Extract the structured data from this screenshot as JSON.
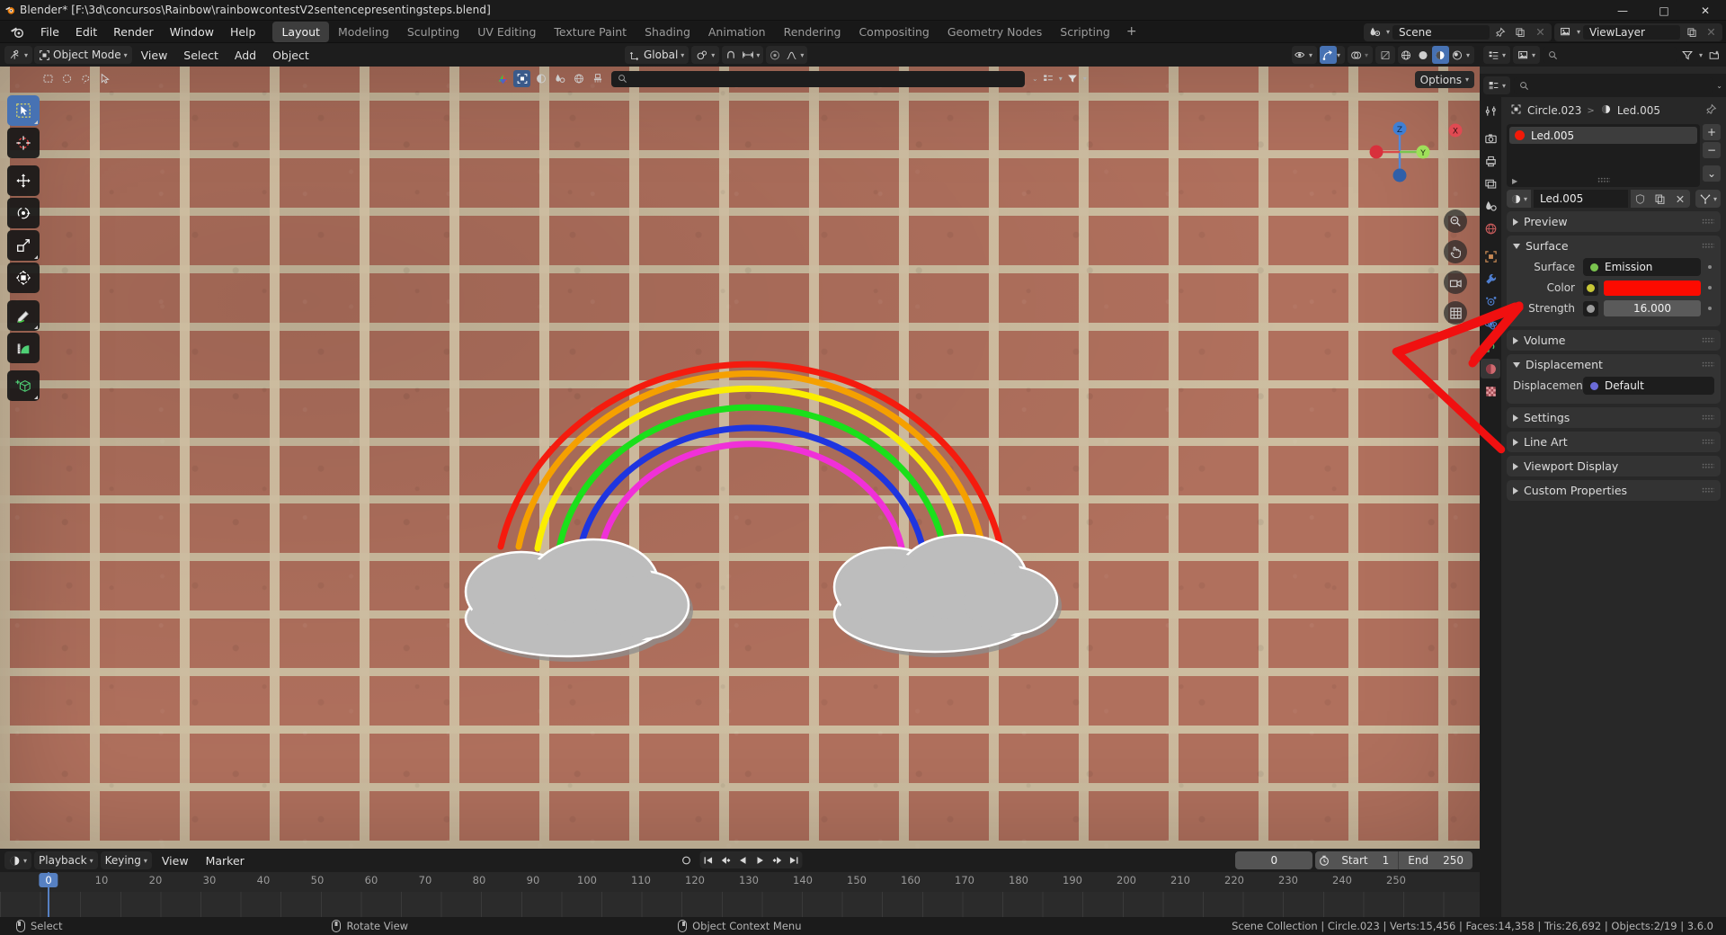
{
  "window": {
    "title": "Blender* [F:\\3d\\concursos\\Rainbow\\rainbowcontestV2sentencepresentingsteps.blend]",
    "minimize": "—",
    "maximize": "□",
    "close": "✕"
  },
  "topbar": {
    "menus": [
      "File",
      "Edit",
      "Render",
      "Window",
      "Help"
    ],
    "workspaces": [
      {
        "label": "Layout",
        "active": true
      },
      {
        "label": "Modeling",
        "active": false
      },
      {
        "label": "Sculpting",
        "active": false
      },
      {
        "label": "UV Editing",
        "active": false
      },
      {
        "label": "Texture Paint",
        "active": false
      },
      {
        "label": "Shading",
        "active": false
      },
      {
        "label": "Animation",
        "active": false
      },
      {
        "label": "Rendering",
        "active": false
      },
      {
        "label": "Compositing",
        "active": false
      },
      {
        "label": "Geometry Nodes",
        "active": false
      },
      {
        "label": "Scripting",
        "active": false
      }
    ],
    "add_workspace": "+",
    "scene_name": "Scene",
    "view_layer_name": "ViewLayer"
  },
  "viewport": {
    "mode": "Object Mode",
    "menus": [
      "View",
      "Select",
      "Add",
      "Object"
    ],
    "transform_orientation": "Global",
    "options_label": "Options",
    "tools": [
      "tweak-select-tool",
      "cursor-tool",
      "move-tool",
      "rotate-tool",
      "scale-tool",
      "transform-tool",
      "annotate-tool",
      "measure-tool",
      "add-cube-tool"
    ],
    "gizmo_axes": {
      "z": "Z",
      "y": "Y",
      "x": "X"
    }
  },
  "rainbow": {
    "arc_colors": [
      "#f51b0e",
      "#f5a000",
      "#fbee00",
      "#1ae01a",
      "#1e35e0",
      "#f030d8"
    ],
    "cloud_color": "#b9b9b9"
  },
  "outliner": {
    "search_placeholder": ""
  },
  "properties": {
    "breadcrumb": {
      "object": "Circle.023",
      "separator": ">",
      "material": "Led.005"
    },
    "material_slot": {
      "name": "Led.005",
      "color": "#f21a08",
      "add": "+",
      "remove": "−"
    },
    "material_name": "Led.005",
    "panels": [
      {
        "label": "Preview",
        "open": false
      },
      {
        "label": "Surface",
        "open": true
      },
      {
        "label": "Volume",
        "open": false
      },
      {
        "label": "Displacement",
        "open": true
      },
      {
        "label": "Settings",
        "open": false
      },
      {
        "label": "Line Art",
        "open": false
      },
      {
        "label": "Viewport Display",
        "open": false
      },
      {
        "label": "Custom Properties",
        "open": false
      }
    ],
    "surface": {
      "surface_label": "Surface",
      "surface_value": "Emission",
      "surface_socket_color": "#7ac44f",
      "color_label": "Color",
      "color_value": "#fc0b00",
      "color_socket_color": "#c7c737",
      "strength_label": "Strength",
      "strength_value": "16.000",
      "strength_socket_color": "#9c9c9c"
    },
    "displacement": {
      "label": "Displacement",
      "value": "Default",
      "socket_color": "#6b6bd8"
    },
    "tabs": [
      "tool-tab",
      "render-tab",
      "output-tab",
      "view-layer-tab",
      "scene-tab",
      "world-tab",
      "object-tab",
      "modifier-tab",
      "particles-tab",
      "physics-tab",
      "constraints-tab",
      "material-tab",
      "texture-tab"
    ]
  },
  "timeline": {
    "editor_menus": [
      "Playback",
      "Keying",
      "View",
      "Marker"
    ],
    "current_frame": "0",
    "start_label": "Start",
    "start_value": "1",
    "end_label": "End",
    "end_value": "250",
    "ticks": [
      "0",
      "10",
      "20",
      "30",
      "40",
      "50",
      "60",
      "70",
      "80",
      "90",
      "100",
      "110",
      "120",
      "130",
      "140",
      "150",
      "160",
      "170",
      "180",
      "190",
      "200",
      "210",
      "220",
      "230",
      "240",
      "250"
    ],
    "playhead_frame": "0"
  },
  "statusbar": {
    "hints": [
      {
        "icon": "mouse-left-icon",
        "label": "Select"
      },
      {
        "icon": "mouse-middle-icon",
        "label": "Rotate View"
      },
      {
        "icon": "mouse-right-icon",
        "label": "Object Context Menu"
      }
    ],
    "stats": "Scene Collection | Circle.023 | Verts:15,456 | Faces:14,358 | Tris:26,692 | Objects:2/19 | 3.6.0"
  }
}
